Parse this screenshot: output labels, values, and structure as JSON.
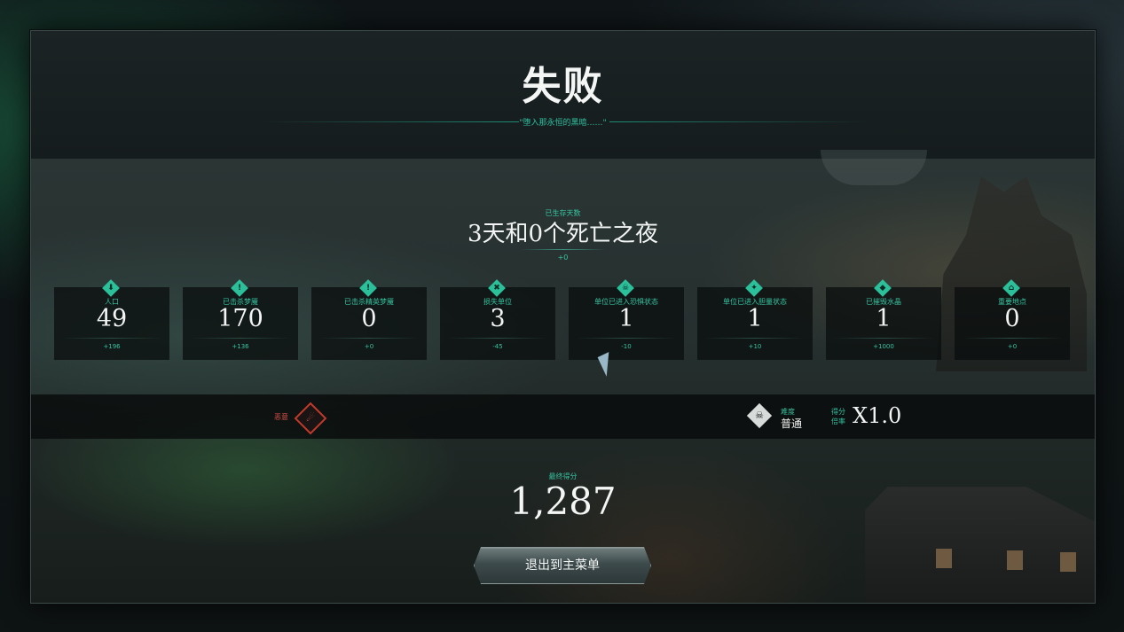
{
  "header": {
    "title": "失败",
    "subtitle": "\"堕入那永恒的黑暗……\""
  },
  "survival": {
    "label": "已生存天数",
    "value": "3天和0个死亡之夜",
    "delta": "+0"
  },
  "stats": [
    {
      "icon": "population-icon",
      "glyph": "⬇",
      "label": "人口",
      "value": "49",
      "delta": "+196"
    },
    {
      "icon": "kill-icon",
      "glyph": "!",
      "label": "已击杀梦魇",
      "value": "170",
      "delta": "+136"
    },
    {
      "icon": "elite-kill-icon",
      "glyph": "!",
      "label": "已击杀精英梦魇",
      "value": "0",
      "delta": "+0"
    },
    {
      "icon": "lost-units-icon",
      "glyph": "✖",
      "label": "损失单位",
      "value": "3",
      "delta": "-45"
    },
    {
      "icon": "skull-icon",
      "glyph": "☠",
      "label": "单位已进入恐惧状态",
      "value": "1",
      "delta": "-10"
    },
    {
      "icon": "brave-icon",
      "glyph": "✦",
      "label": "单位已进入胆量状态",
      "value": "1",
      "delta": "+10"
    },
    {
      "icon": "crystal-icon",
      "glyph": "◆",
      "label": "已摧毁水晶",
      "value": "1",
      "delta": "+1000"
    },
    {
      "icon": "landmark-icon",
      "glyph": "⌂",
      "label": "重要地点",
      "value": "0",
      "delta": "+0"
    }
  ],
  "modifiers": {
    "malice_label": "恶意",
    "malice_icon": "malice-icon",
    "difficulty_label": "难度",
    "difficulty_value": "普通",
    "difficulty_icon": "difficulty-skull-icon",
    "multiplier_label": "得分倍率",
    "multiplier_value": "X1.0"
  },
  "final_score": {
    "label": "最终得分",
    "value": "1,287"
  },
  "exit_button": {
    "label": "退出到主菜单"
  },
  "colors": {
    "accent": "#37c3a0",
    "danger": "#c0392b",
    "text": "#f2f4f3"
  }
}
